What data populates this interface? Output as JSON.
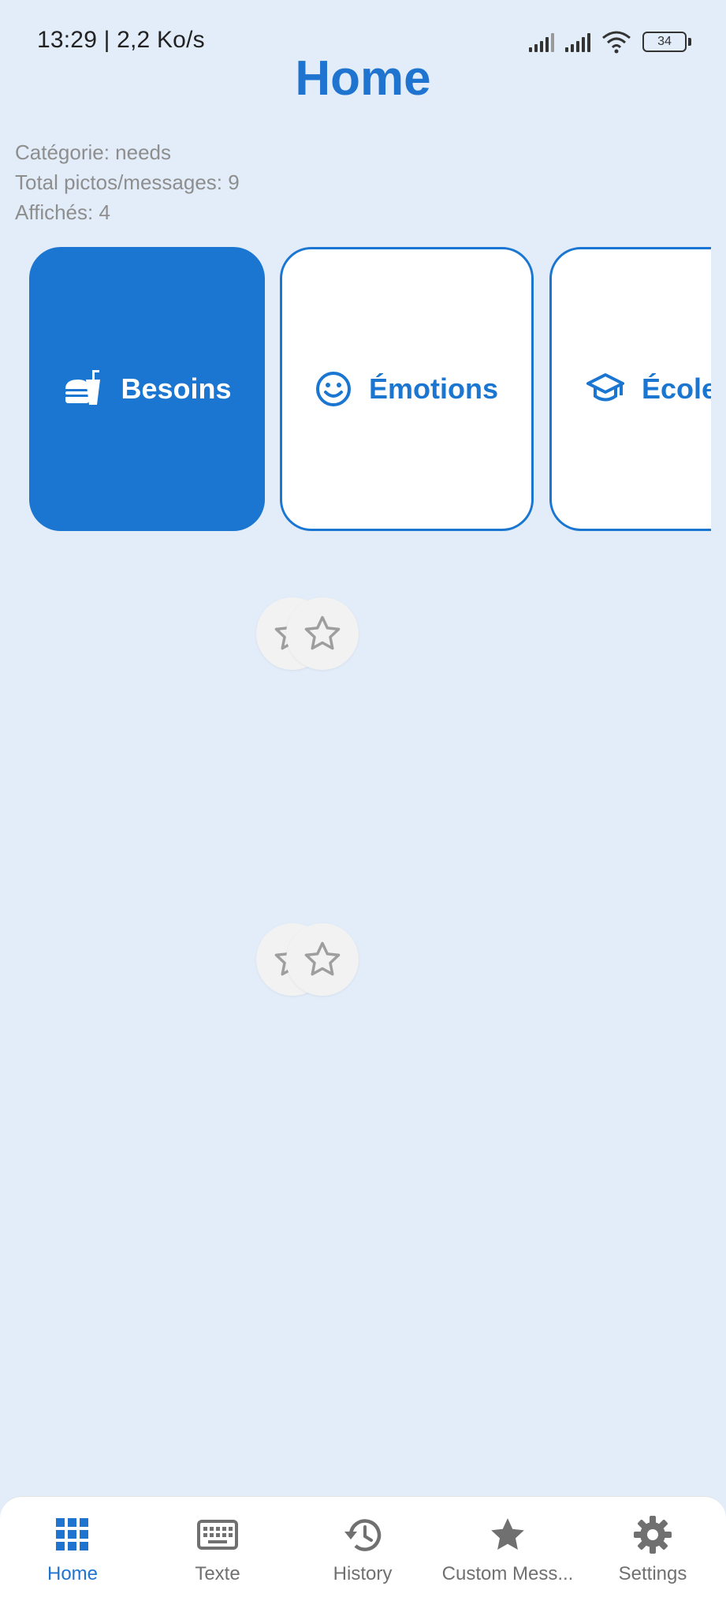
{
  "status_bar": {
    "time_speed": "13:29 | 2,2 Ko/s",
    "battery": "34"
  },
  "header": {
    "title": "Home"
  },
  "info": {
    "category": "Catégorie: needs",
    "total": "Total pictos/messages: 9",
    "shown": "Affichés: 4"
  },
  "categories": [
    {
      "label": "Besoins",
      "icon": "food-icon",
      "active": true
    },
    {
      "label": "Émotions",
      "icon": "smile-icon",
      "active": false
    },
    {
      "label": "École",
      "icon": "graduation-cap-icon",
      "active": false
    }
  ],
  "bottom_nav": [
    {
      "label": "Home",
      "icon": "grid-icon",
      "active": true
    },
    {
      "label": "Texte",
      "icon": "keyboard-icon",
      "active": false
    },
    {
      "label": "History",
      "icon": "history-icon",
      "active": false
    },
    {
      "label": "Custom Mess...",
      "icon": "star-icon",
      "active": false
    },
    {
      "label": "Settings",
      "icon": "gear-icon",
      "active": false
    }
  ],
  "colors": {
    "accent": "#1B76D1",
    "background": "#E2EDF9",
    "muted_text": "#8E8E8E"
  }
}
